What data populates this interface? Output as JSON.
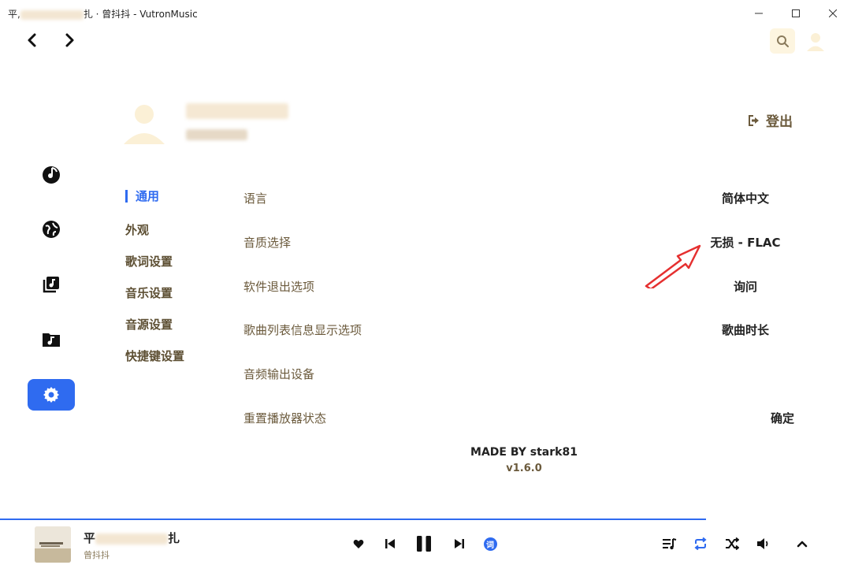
{
  "window": {
    "title_prefix": "平,",
    "title_suffix": "扎 · 曾抖抖 - VutronMusic"
  },
  "profile": {
    "logout_label": "登出"
  },
  "categories": [
    {
      "label": "通用"
    },
    {
      "label": "外观"
    },
    {
      "label": "歌词设置"
    },
    {
      "label": "音乐设置"
    },
    {
      "label": "音源设置"
    },
    {
      "label": "快捷键设置"
    }
  ],
  "settings": [
    {
      "label": "语言",
      "value": "简体中文"
    },
    {
      "label": "音质选择",
      "value": "无损 - FLAC"
    },
    {
      "label": "软件退出选项",
      "value": "询问"
    },
    {
      "label": "歌曲列表信息显示选项",
      "value": "歌曲时长"
    },
    {
      "label": "音频输出设备",
      "value": ""
    },
    {
      "label": "重置播放器状态",
      "value": "确定"
    }
  ],
  "footer": {
    "credits": "MADE BY stark81",
    "version": "v1.6.0"
  },
  "player": {
    "title_prefix": "平",
    "title_suffix": "扎",
    "artist": "曾抖抖",
    "lyrics_btn": "词",
    "progress_percent": 83
  },
  "colors": {
    "accent": "#2f6bf0",
    "label": "#6b5a3c",
    "search_bg": "#fdf5e0"
  },
  "icons": {
    "sidebar": [
      "music-disc-icon",
      "globe-icon",
      "library-icon",
      "music-folder-icon",
      "settings-gear-icon"
    ]
  }
}
